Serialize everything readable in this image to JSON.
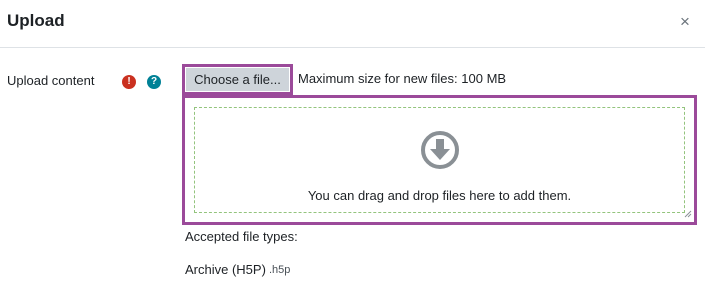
{
  "dialog": {
    "title": "Upload",
    "close_symbol": "×"
  },
  "field": {
    "label": "Upload content",
    "required_icon": "exclamation-icon",
    "help_icon": "question-icon",
    "required_symbol": "!",
    "help_symbol": "?"
  },
  "filepicker": {
    "choose_button_label": "Choose a file...",
    "max_size_text": "Maximum size for new files: 100 MB"
  },
  "dropzone": {
    "icon": "download-arrow-icon",
    "message": "You can drag and drop files here to add them."
  },
  "accepted": {
    "label": "Accepted file types:",
    "types": [
      {
        "name": "Archive (H5P)",
        "ext": ".h5p"
      }
    ]
  },
  "colors": {
    "highlight": "#9b4a9a",
    "required": "#ca3120",
    "help": "#008196",
    "dropzone_border": "#93c47d"
  }
}
